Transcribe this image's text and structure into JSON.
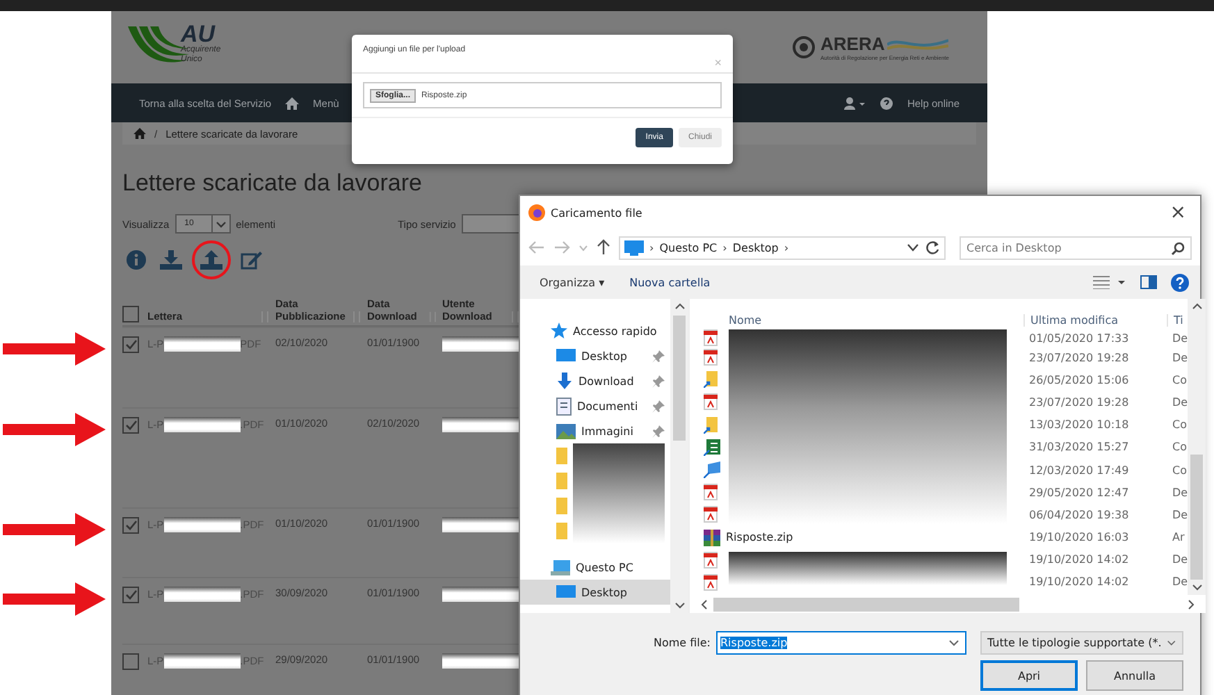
{
  "page": {
    "logo": {
      "initials": "AU",
      "line1": "Acquirente",
      "line2": "Unico"
    },
    "partner_logo": {
      "name": "ARERA",
      "subtitle": "Autorità di Regolazione per Energia Reti e Ambiente"
    },
    "nav": {
      "back": "Torna alla scelta del Servizio",
      "menu": "Menù",
      "help": "Help online"
    },
    "breadcrumb": {
      "separator": "/",
      "text": "Lettere scaricate da lavorare"
    },
    "title": "Lettere scaricate da lavorare",
    "show": {
      "label": "Visualizza",
      "value": "10",
      "suffix": "elementi"
    },
    "service_filter": {
      "label": "Tipo servizio"
    },
    "toolbar_icons": [
      {
        "kind": "info",
        "highlighted": false
      },
      {
        "kind": "download",
        "highlighted": false
      },
      {
        "kind": "upload",
        "highlighted": true
      },
      {
        "kind": "edit",
        "highlighted": false
      }
    ],
    "table": {
      "select_all_checked": false,
      "columns": [
        "Lettera",
        "Data Pubblicazione",
        "Data Download",
        "Utente Download"
      ],
      "rows": [
        {
          "checked": true,
          "arrow": true,
          "prefix": "L-P",
          "suffix": "PDF",
          "published": "02/10/2020",
          "downloaded": "01/01/1900"
        },
        {
          "checked": true,
          "arrow": true,
          "prefix": "L-P",
          "suffix": ".PDF",
          "published": "01/10/2020",
          "downloaded": "02/10/2020"
        },
        {
          "checked": true,
          "arrow": true,
          "prefix": "L-P",
          "suffix": ".PDF",
          "published": "01/10/2020",
          "downloaded": "01/01/1900"
        },
        {
          "checked": true,
          "arrow": true,
          "prefix": "L-P",
          "suffix": ".PDF",
          "published": "30/09/2020",
          "downloaded": "01/01/1900"
        },
        {
          "checked": false,
          "arrow": false,
          "prefix": "L-P",
          "suffix": ".PDF",
          "published": "29/09/2020",
          "downloaded": "01/01/1900"
        }
      ]
    }
  },
  "upload_modal": {
    "title": "Aggiungi un file per l'upload",
    "close": "×",
    "browse": "Sfoglia...",
    "file": "Risposte.zip",
    "buttons": [
      {
        "label": "Invia",
        "kind": "primary"
      },
      {
        "label": "Chiudi",
        "kind": "default"
      }
    ]
  },
  "file_dialog": {
    "title": "Caricamento file",
    "close": "×",
    "path": [
      {
        "kind": "separator",
        "text": "›"
      },
      {
        "kind": "segment",
        "text": "Questo PC"
      },
      {
        "kind": "separator",
        "text": "›"
      },
      {
        "kind": "segment",
        "text": "Desktop"
      },
      {
        "kind": "separator",
        "text": "›"
      }
    ],
    "search_placeholder": "Cerca in Desktop",
    "toolbar": {
      "organize": "Organizza ▾",
      "new_folder": "Nuova cartella"
    },
    "nav": [
      {
        "label": "Accesso rapido",
        "kind": "star",
        "selected": false,
        "children": [
          {
            "label": "Desktop",
            "kind": "desktop",
            "pinned": true,
            "selected": false
          },
          {
            "label": "Download",
            "kind": "download",
            "pinned": true,
            "selected": false
          },
          {
            "label": "Documenti",
            "kind": "documents",
            "pinned": true,
            "selected": false
          },
          {
            "label": "Immagini",
            "kind": "images",
            "pinned": true,
            "selected": false
          },
          {
            "kind": "folder",
            "selected": false
          },
          {
            "kind": "folder",
            "selected": false
          },
          {
            "kind": "folder",
            "selected": false
          },
          {
            "kind": "folder",
            "selected": false
          }
        ]
      },
      {
        "label": "Questo PC",
        "kind": "pc",
        "selected": false,
        "children": [
          {
            "label": "Desktop",
            "kind": "desktop",
            "selected": true
          }
        ]
      }
    ],
    "columns": [
      "Nome",
      "Ultima modifica",
      "Ti"
    ],
    "files": [
      {
        "kind": "pdf",
        "date": "01/05/2020 17:33",
        "type": "De"
      },
      {
        "kind": "pdf",
        "date": "23/07/2020 19:28",
        "type": "De"
      },
      {
        "kind": "shortcut",
        "date": "26/05/2020 15:06",
        "type": "Co"
      },
      {
        "kind": "pdf",
        "date": "23/07/2020 19:28",
        "type": "De"
      },
      {
        "kind": "shortcut",
        "date": "13/03/2020 10:18",
        "type": "Co"
      },
      {
        "kind": "sheet",
        "date": "31/03/2020 15:27",
        "type": "Co"
      },
      {
        "kind": "remote",
        "date": "12/03/2020 17:49",
        "type": "Co"
      },
      {
        "kind": "pdf",
        "date": "29/05/2020 12:47",
        "type": "De"
      },
      {
        "kind": "pdf",
        "date": "06/04/2020 19:38",
        "type": "De"
      },
      {
        "kind": "zip",
        "name": "Risposte.zip",
        "date": "19/10/2020 16:03",
        "type": "Ar"
      },
      {
        "kind": "pdf",
        "date": "19/10/2020 14:02",
        "type": "De"
      },
      {
        "kind": "pdf",
        "date": "19/10/2020 14:02",
        "type": "De"
      }
    ],
    "file_name": {
      "label": "Nome file:",
      "value": "Risposte.zip"
    },
    "file_type": "Tutte le tipologie supportate (*.",
    "buttons": [
      {
        "label": "Apri",
        "kind": "primary"
      },
      {
        "label": "Annulla",
        "kind": "default"
      }
    ]
  }
}
